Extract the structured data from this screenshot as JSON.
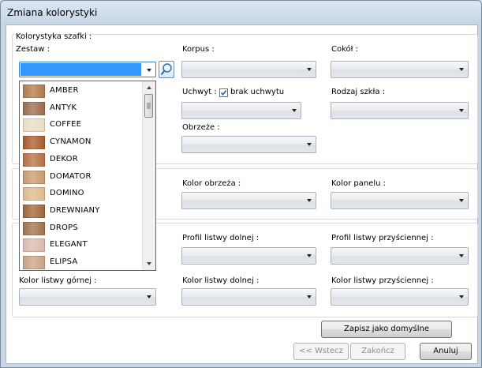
{
  "window": {
    "title": "Zmiana kolorystyki"
  },
  "group_main": {
    "label": "Kolorystyka szafki :"
  },
  "fields": {
    "zestaw": {
      "label": "Zestaw :",
      "value": ""
    },
    "korpus": {
      "label": "Korpus :",
      "value": ""
    },
    "cokol": {
      "label": "Cokół :",
      "value": ""
    },
    "uchwyt": {
      "label": "Uchwyt :",
      "value": ""
    },
    "brak_uchwytu": {
      "label": "brak uchwytu",
      "checked": true
    },
    "rodzaj_szkla": {
      "label": "Rodzaj szkła :",
      "value": ""
    },
    "obrzeze": {
      "label": "Obrzeże :",
      "value": ""
    },
    "kolor_obrzeza": {
      "label": "Kolor obrzeża :",
      "value": ""
    },
    "kolor_panelu": {
      "label": "Kolor panelu :",
      "value": ""
    },
    "profil_listwy_dolnej": {
      "label": "Profil listwy dolnej :",
      "value": ""
    },
    "profil_listwy_przysciennej": {
      "label": "Profil listwy przyściennej :",
      "value": ""
    },
    "kolor_listwy_gornej": {
      "label": "Kolor listwy górnej :",
      "value": ""
    },
    "kolor_listwy_dolnej": {
      "label": "Kolor listwy dolnej :",
      "value": ""
    },
    "kolor_listwy_przysciennej": {
      "label": "Kolor listwy przyściennej :",
      "value": ""
    }
  },
  "dropdown": {
    "items": [
      {
        "label": "AMBER",
        "color": "#b07846"
      },
      {
        "label": "ANTYK",
        "color": "#9a6a4a"
      },
      {
        "label": "COFFEE",
        "color": "#e9dcc2"
      },
      {
        "label": "CYNAMON",
        "color": "#a8592a"
      },
      {
        "label": "DEKOR",
        "color": "#b36e41"
      },
      {
        "label": "DOMATOR",
        "color": "#c89a69"
      },
      {
        "label": "DOMINO",
        "color": "#ddb98a"
      },
      {
        "label": "DREWNIANY",
        "color": "#9c6536"
      },
      {
        "label": "DROPS",
        "color": "#a06f4c"
      },
      {
        "label": "ELEGANT",
        "color": "#d8b9ac"
      },
      {
        "label": "ELIPSA",
        "color": "#c9a184"
      }
    ]
  },
  "buttons": {
    "save_default": "Zapisz jako domyślne",
    "back": "<< Wstecz",
    "finish": "Zakończ",
    "cancel": "Anuluj"
  }
}
